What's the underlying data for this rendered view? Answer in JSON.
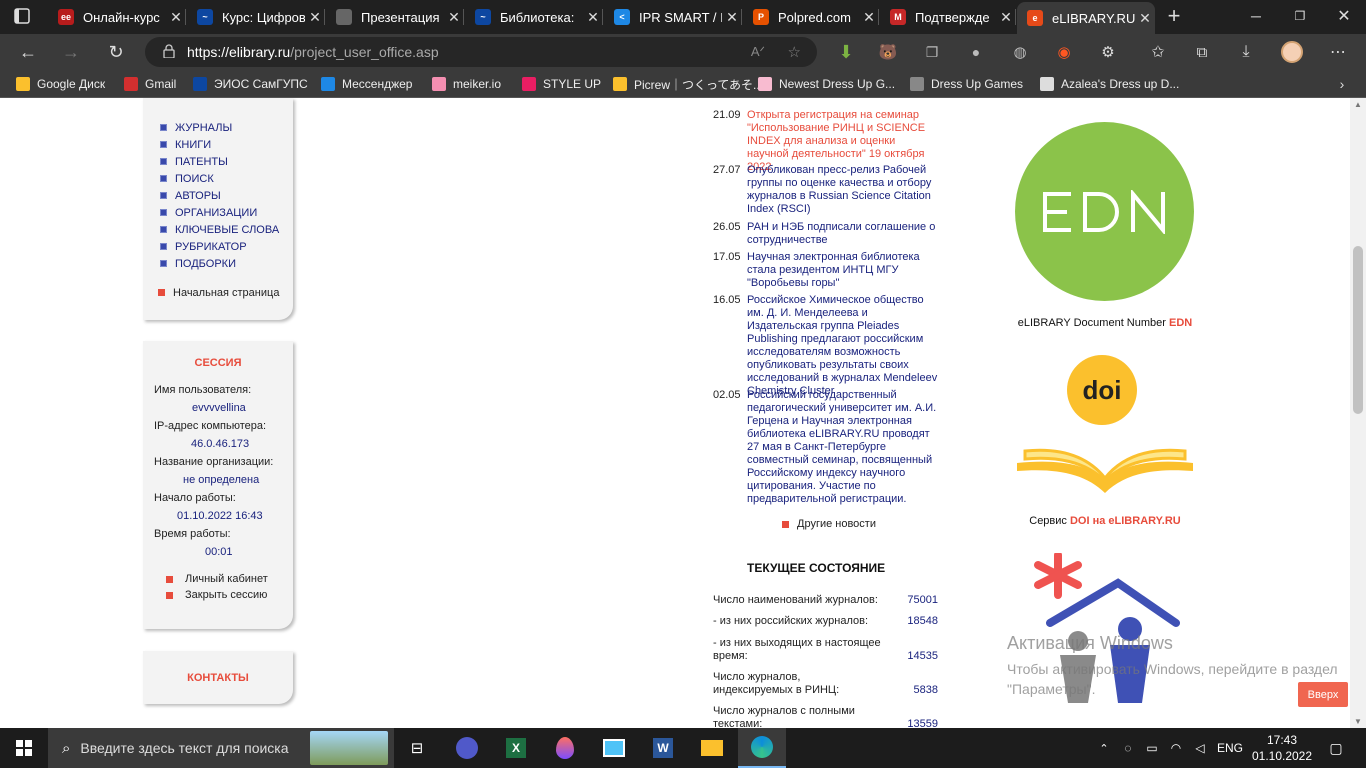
{
  "browser": {
    "tabs": [
      {
        "title": "Онлайн-курс",
        "color": "#b71c1c",
        "glyph": "ee"
      },
      {
        "title": "Курс: Цифров",
        "color": "#0d47a1",
        "glyph": "~"
      },
      {
        "title": "Презентация",
        "color": "#666666",
        "glyph": ""
      },
      {
        "title": "Библиотека:",
        "color": "#0d47a1",
        "glyph": "~"
      },
      {
        "title": "IPR SMART / I",
        "color": "#1e88e5",
        "glyph": "<"
      },
      {
        "title": "Polpred.com",
        "color": "#e65100",
        "glyph": "P"
      },
      {
        "title": "Подтвержде",
        "color": "#c62828",
        "glyph": "M"
      },
      {
        "title": "eLIBRARY.RU",
        "color": "#e64a19",
        "glyph": "e"
      }
    ],
    "url_prefix": "https://elibrary.ru",
    "url_path": "/project_user_office.asp",
    "bookmarks": [
      {
        "label": "Google Диск",
        "color": "#fbc02d"
      },
      {
        "label": "Gmail",
        "color": "#d32f2f"
      },
      {
        "label": "ЭИОС СамГУПС",
        "color": "#0d47a1"
      },
      {
        "label": "Мессенджер",
        "color": "#1e88e5"
      },
      {
        "label": "meiker.io",
        "color": "#f48fb1"
      },
      {
        "label": "STYLE UP",
        "color": "#e91e63"
      },
      {
        "label": "Picrew｜つくってあそ...",
        "color": "#fbc02d"
      },
      {
        "label": "Newest Dress Up G...",
        "color": "#f8bbd0"
      },
      {
        "label": "Dress Up Games",
        "color": "#888888"
      },
      {
        "label": "Azalea's Dress up D...",
        "color": "#dddddd"
      }
    ]
  },
  "sidebar": {
    "menu": [
      "ЖУРНАЛЫ",
      "КНИГИ",
      "ПАТЕНТЫ",
      "ПОИСК",
      "АВТОРЫ",
      "ОРГАНИЗАЦИИ",
      "КЛЮЧЕВЫЕ СЛОВА",
      "РУБРИКАТОР",
      "ПОДБОРКИ"
    ],
    "home_link": "Начальная страница",
    "session": {
      "title": "СЕССИЯ",
      "username_label": "Имя пользователя:",
      "username": "evvvvellina",
      "ip_label": "IP-адрес компьютера:",
      "ip": "46.0.46.173",
      "org_label": "Название организации:",
      "org": "не определена",
      "start_label": "Начало работы:",
      "start": "01.10.2022 16:43",
      "time_label": "Время работы:",
      "time": "00:01",
      "cabinet": "Личный кабинет",
      "close": "Закрыть сессию"
    },
    "contacts": "КОНТАКТЫ"
  },
  "news": [
    {
      "date": "21.09",
      "text": "Открыта регистрация на семинар \"Использование РИНЦ и SCIENCE INDEX для анализа и оценки научной деятельности\" 19 октября 2022",
      "highlight": true
    },
    {
      "date": "27.07",
      "text": "Опубликован пресс-релиз Рабочей группы по оценке качества и отбору журналов в Russian Science Citation Index (RSCI)"
    },
    {
      "date": "26.05",
      "text": "РАН и НЭБ подписали соглашение о сотрудничестве"
    },
    {
      "date": "17.05",
      "text": "Научная электронная библиотека стала резидентом ИНТЦ МГУ \"Воробьевы горы\""
    },
    {
      "date": "16.05",
      "text": "Российское Химическое общество им. Д. И. Менделеева и Издательская группа Pleiades Publishing предлагают российским исследователям возможность опубликовать результаты своих исследований в журналах Mendeleev Chemistry Cluster"
    },
    {
      "date": "02.05",
      "text": "Российский государственный педагогический университет им. А.И. Герцена и Научная электронная библиотека eLIBRARY.RU проводят 27 мая в Санкт-Петербурге совместный семинар, посвященный Российскому индексу научного цитирования. Участие по предварительной регистрации."
    }
  ],
  "other_news": "Другие новости",
  "status": {
    "title": "ТЕКУЩЕЕ СОСТОЯНИЕ",
    "rows": [
      {
        "label": "Число наименований журналов:",
        "value": "75001"
      },
      {
        "label": "- из них российских журналов:",
        "value": "18548"
      },
      {
        "label": "- из них выходящих в настоящее время:",
        "value": "14535"
      },
      {
        "label": "Число журналов, индексируемых в РИНЦ:",
        "value": "5838"
      },
      {
        "label": "Число журналов с полными текстами:",
        "value": "13559"
      }
    ]
  },
  "right": {
    "edn_logo": "EDN",
    "edn_caption": "eLIBRARY Document Number ",
    "edn_caption_hl": "EDN",
    "doi_logo": "doi",
    "doi_caption": "Сервис ",
    "doi_caption_hl": "DOI на eLIBRARY.RU",
    "colors": {
      "edn": "#8bc34a",
      "doi": "#fbc02d",
      "accent": "#e74c3c"
    }
  },
  "watermark": {
    "title": "Активация Windows",
    "text": "Чтобы активировать Windows, перейдите в раздел \"Параметры\"."
  },
  "up_button": "Вверх",
  "taskbar": {
    "search_placeholder": "Введите здесь текст для поиска",
    "lang": "ENG",
    "time": "17:43",
    "date": "01.10.2022"
  }
}
